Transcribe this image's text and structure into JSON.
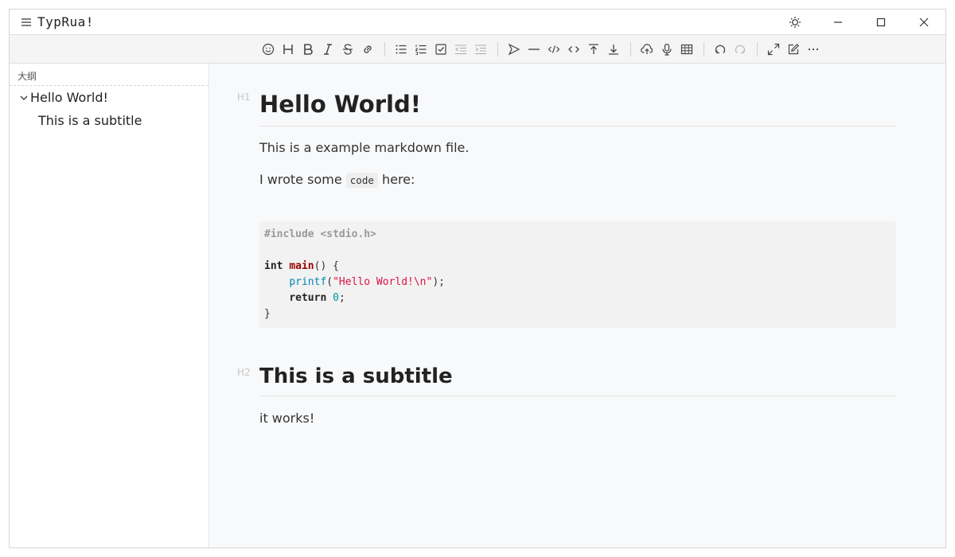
{
  "app": {
    "title": "TypRua!"
  },
  "toolbar": {
    "groups": [
      [
        "emoji-icon",
        "heading-icon",
        "bold-icon",
        "italic-icon",
        "strike-icon",
        "link-icon"
      ],
      [
        "unordered-list-icon",
        "ordered-list-icon",
        "check-list-icon",
        "outdent-icon",
        "indent-icon"
      ],
      [
        "quote-icon",
        "line-icon",
        "code-icon",
        "inline-code-icon",
        "insert-before-icon",
        "insert-after-icon"
      ],
      [
        "upload-icon",
        "record-icon",
        "table-icon"
      ],
      [
        "undo-icon",
        "redo-icon"
      ],
      [
        "fullscreen-icon",
        "edit-mode-icon",
        "more-icon"
      ]
    ]
  },
  "sidebar": {
    "title": "大纲",
    "items": [
      {
        "label": "Hello World!",
        "level": 1
      },
      {
        "label": "This is a subtitle",
        "level": 2
      }
    ]
  },
  "editor": {
    "h1_label": "H1",
    "h1": "Hello World!",
    "p1": "This is a example markdown file.",
    "p2_before": "I wrote some",
    "p2_code": "code",
    "p2_after": "here:",
    "code": {
      "line1": "#include <stdio.h>",
      "line3_kw": "int",
      "line3_fn": "main",
      "line3_rest": "() {",
      "line4_indent": "    ",
      "line4_fn": "printf",
      "line4_open": "(",
      "line4_str": "\"Hello World!\\n\"",
      "line4_close": ");",
      "line5_indent": "    ",
      "line5_kw": "return",
      "line5_num": "0",
      "line5_end": ";",
      "line6": "}"
    },
    "h2_label": "H2",
    "h2": "This is a subtitle",
    "p3": "it works!"
  }
}
